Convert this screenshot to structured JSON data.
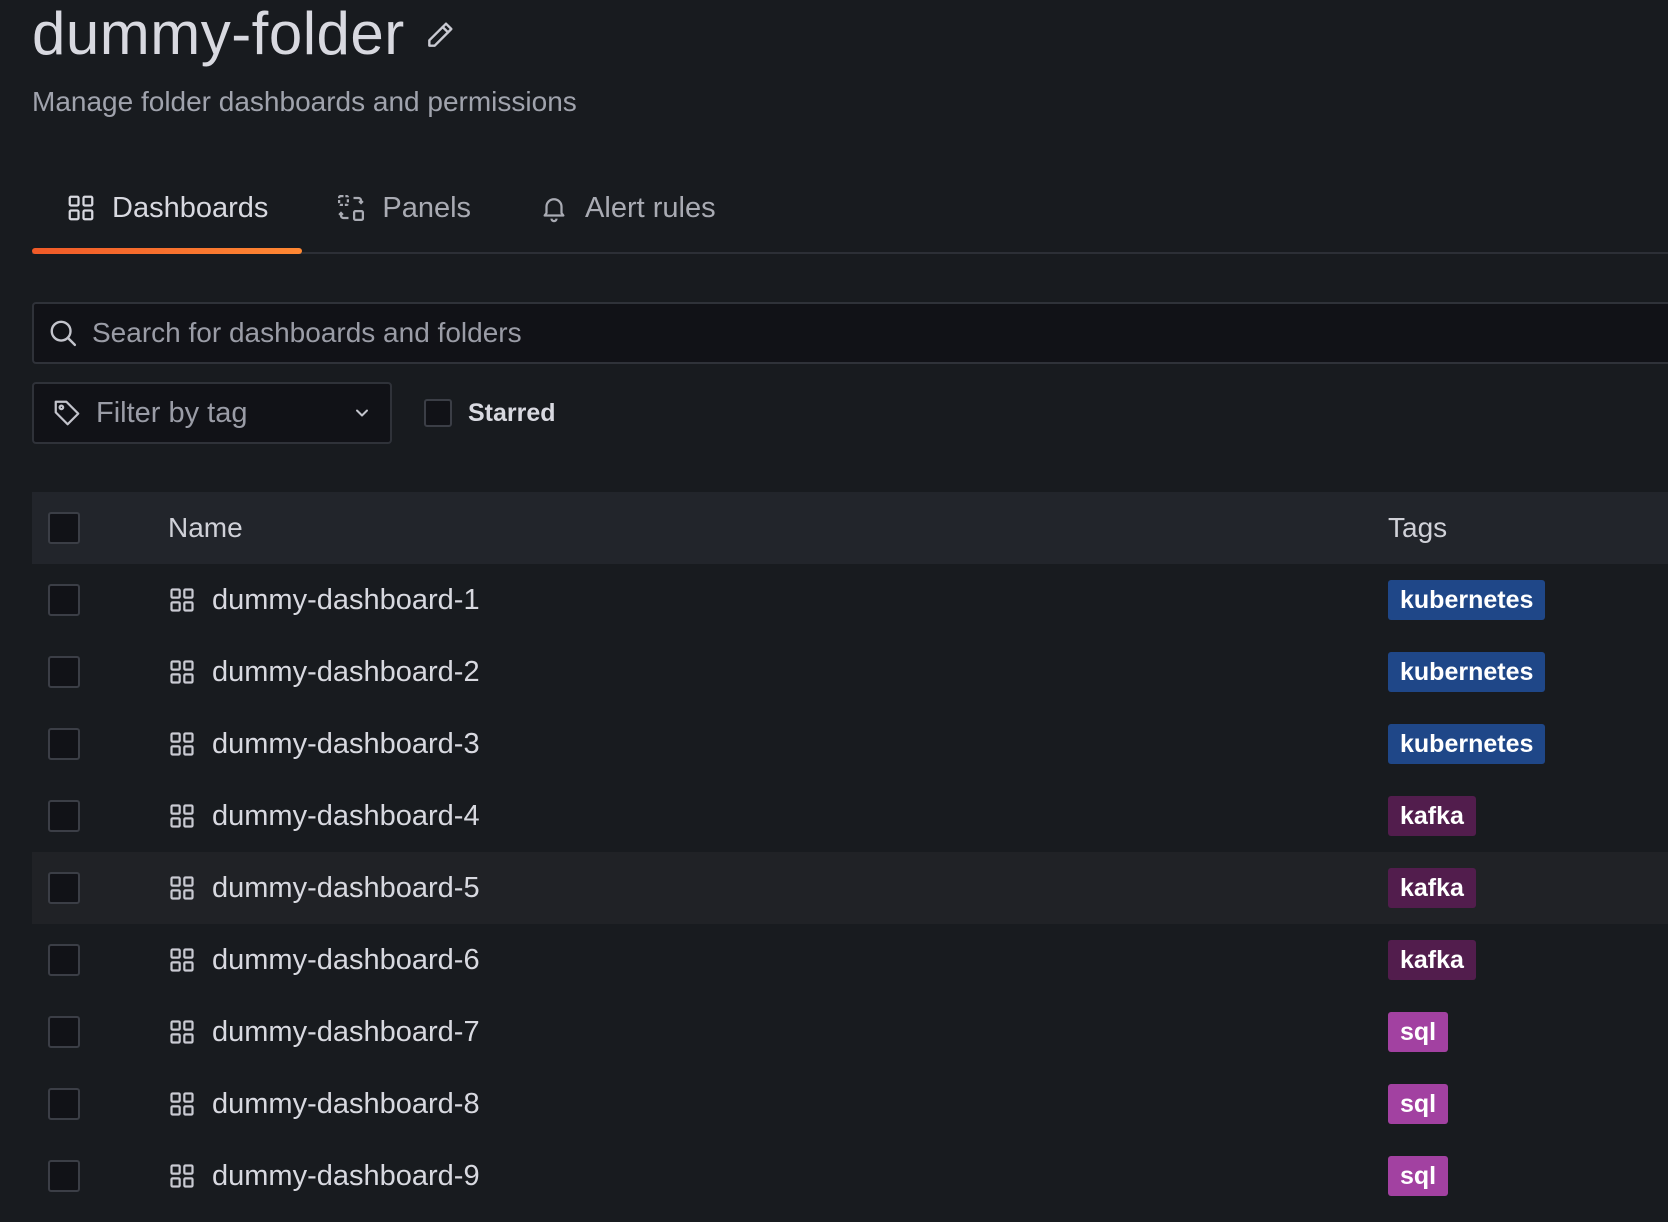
{
  "folder": {
    "title": "dummy-folder",
    "subtitle": "Manage folder dashboards and permissions"
  },
  "tabs": [
    {
      "label": "Dashboards",
      "icon": "apps-icon",
      "active": true
    },
    {
      "label": "Panels",
      "icon": "library-panel-icon",
      "active": false
    },
    {
      "label": "Alert rules",
      "icon": "bell-icon",
      "active": false
    }
  ],
  "search": {
    "placeholder": "Search for dashboards and folders",
    "value": ""
  },
  "filters": {
    "tag_placeholder": "Filter by tag",
    "starred_label": "Starred"
  },
  "table": {
    "columns": {
      "name": "Name",
      "tags": "Tags"
    },
    "rows": [
      {
        "name": "dummy-dashboard-1",
        "tag": "kubernetes",
        "tag_color": "#1f4788"
      },
      {
        "name": "dummy-dashboard-2",
        "tag": "kubernetes",
        "tag_color": "#1f4788"
      },
      {
        "name": "dummy-dashboard-3",
        "tag": "kubernetes",
        "tag_color": "#1f4788"
      },
      {
        "name": "dummy-dashboard-4",
        "tag": "kafka",
        "tag_color": "#521d4d"
      },
      {
        "name": "dummy-dashboard-5",
        "tag": "kafka",
        "tag_color": "#521d4d"
      },
      {
        "name": "dummy-dashboard-6",
        "tag": "kafka",
        "tag_color": "#521d4d"
      },
      {
        "name": "dummy-dashboard-7",
        "tag": "sql",
        "tag_color": "#a241a1"
      },
      {
        "name": "dummy-dashboard-8",
        "tag": "sql",
        "tag_color": "#a241a1"
      },
      {
        "name": "dummy-dashboard-9",
        "tag": "sql",
        "tag_color": "#a241a1"
      }
    ]
  },
  "colors": {
    "background": "#181b1f",
    "accent": "#f05a28"
  }
}
